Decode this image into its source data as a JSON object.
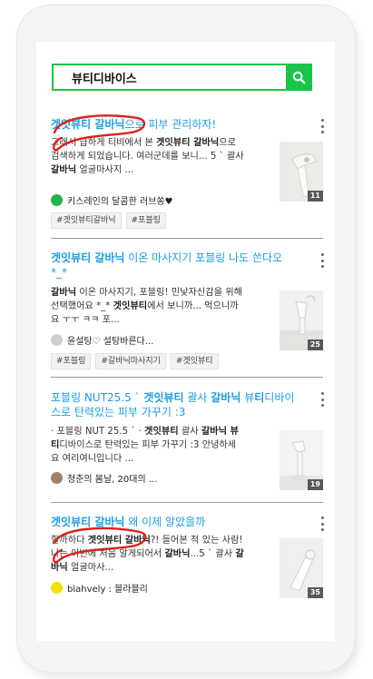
{
  "search": {
    "query": "뷰티디바이스"
  },
  "posts": [
    {
      "title_pre": "",
      "title_bold": "겟잇뷰티 갈바닉",
      "title_post": "으로 피부 관리하자!",
      "desc": [
        {
          "t": "그래서 급하게 티비에서 본 "
        },
        {
          "b": "겟잇뷰티 갈바닉"
        },
        {
          "t": "으로 검색하게 되었습니다. 여러군데를 보니... 5 ` 괄사 "
        },
        {
          "b": "갈바닉"
        },
        {
          "t": " 얼굴마사지 ..."
        }
      ],
      "author": "키스레인의 달콤한 러브쏭♥",
      "author_color": "#24b34a",
      "count": "11",
      "tags": [
        "#겟잇뷰티갈바닉",
        "#포블링"
      ]
    },
    {
      "title_pre": "",
      "title_bold": "겟잇뷰티 갈바닉",
      "title_post": " 이온 마사지기 포블링 나도 쓴다오 *_*",
      "desc": [
        {
          "b": "갈바닉"
        },
        {
          "t": " 이온 마사지기, 포블링! 민낯자신감을 위해 선택했어요 *_* "
        },
        {
          "b": "겟잇뷰티"
        },
        {
          "t": "에서 보니까... 먹으니까요 ㅜㅜ ㅋㅋ 포..."
        }
      ],
      "author": "윤설탕♡ 설탕바른다...",
      "author_color": "#cfcfcf",
      "count": "25",
      "tags": [
        "#포블링",
        "#갈바닉마사지기",
        "#겟잇뷰티"
      ]
    },
    {
      "title_pre": "포블링 NUT25.5 ` ",
      "title_bold": "겟잇뷰티",
      "title_post": " 괄사 ",
      "title_bold2": "갈바닉",
      "title_post2": " 뷰",
      "title_bold3": "티",
      "title_post3": "디바이스로 탄력있는 피부 가꾸기 :3",
      "desc": [
        {
          "t": "· 포블링 NUT 25.5 ` · "
        },
        {
          "b": "겟잇뷰티"
        },
        {
          "t": " 괄사 "
        },
        {
          "b": "갈바닉 뷰티"
        },
        {
          "t": "디바이스로 탄력있는 피부 가꾸기 :3 안녕하세요 여리여니입니다 ..."
        }
      ],
      "author": "청춘의 봄날, 20대의 ...",
      "author_color": "#a08068",
      "count": "19",
      "tags": []
    },
    {
      "title_pre": "",
      "title_bold": "겟잇뷰티 갈바닉",
      "title_post": " 왜 이제 알았을까",
      "desc": [
        {
          "t": "할까하다 "
        },
        {
          "b": "겟잇뷰티 갈바닉"
        },
        {
          "t": "?! 들어본 적 있는 사람! 나는 이번에 처음 알게되어서 "
        },
        {
          "b": "갈바닉"
        },
        {
          "t": "...5 ` 괄사 "
        },
        {
          "b": "갈바닉"
        },
        {
          "t": " 얼굴마사..."
        }
      ],
      "author": "blahvely : 블라블리",
      "author_color": "#f5e000",
      "count": "35",
      "tags": []
    }
  ]
}
